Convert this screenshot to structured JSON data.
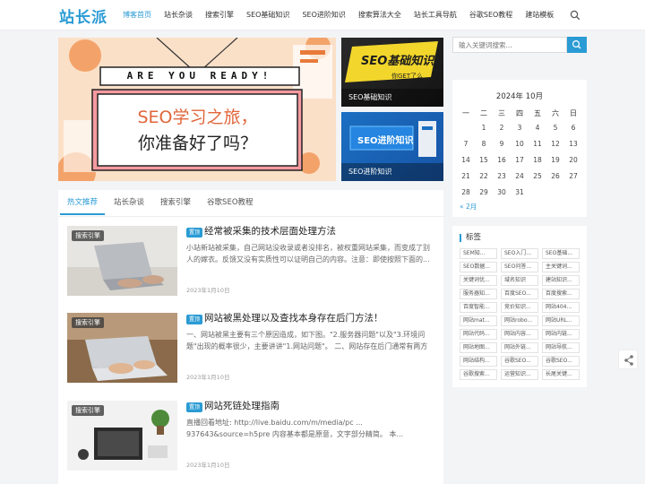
{
  "header": {
    "logo": "站长派",
    "nav": [
      "博客首页",
      "站长杂谈",
      "搜索引擎",
      "SEO基础知识",
      "SEO进阶知识",
      "搜索算法大全",
      "站长工具导航",
      "谷歌SEO教程",
      "建站模板"
    ],
    "active_index": 0
  },
  "slider": {
    "banner_top": "ARE YOU READY!",
    "banner_line1": "SEO学习之旅，",
    "banner_line2": "你准备好了吗？"
  },
  "thumbs": [
    {
      "art_title": "SEO基础知识",
      "art_sub": "你GET了么",
      "caption": "SEO基础知识"
    },
    {
      "art_title": "SEO进阶知识",
      "caption": "SEO进阶知识"
    }
  ],
  "tabs": [
    "热文推荐",
    "站长杂谈",
    "搜索引擎",
    "谷歌SEO教程"
  ],
  "posts": [
    {
      "tag": "搜索引擎",
      "badge": "置顶",
      "title": "经常被采集的技术层面处理方法",
      "summary": "小站新站被采集，自己网站没收录或者没排名，被权重网站采集，而变成了别人的嫁衣。反馈又没有实质性可以证明自己的内容。注意：即使按照下面的...",
      "date": "2023年1月10日"
    },
    {
      "tag": "搜索引擎",
      "badge": "置顶",
      "title": "网站被黑处理以及查找本身存在后门方法！",
      "summary": "一、网站被黑主要有三个原因造成，如下图。\"2.服务器问题\"以及\"3.环境问题\"出现的概率很少，主要讲讲\"1.网站问题\"。 二、网站存在后门通常有两方面...",
      "date": "2023年1月10日"
    },
    {
      "tag": "搜索引擎",
      "badge": "置顶",
      "title": "网站死链处理指南",
      "summary": "直播回看地址: http://live.baidu.com/m/media/pc ... 937643&source=h5pre 内容基本都是原意，文字部分精简。 本...",
      "date": "2023年1月10日"
    }
  ],
  "sidebar": {
    "search_placeholder": "输入关键词搜索...",
    "calendar": {
      "title": "2024年 10月",
      "weekdays": [
        "一",
        "二",
        "三",
        "四",
        "五",
        "六",
        "日"
      ],
      "days": [
        "",
        "1",
        "2",
        "3",
        "4",
        "5",
        "6",
        "7",
        "8",
        "9",
        "10",
        "11",
        "12",
        "13",
        "14",
        "15",
        "16",
        "17",
        "18",
        "19",
        "20",
        "21",
        "22",
        "23",
        "24",
        "25",
        "26",
        "27",
        "28",
        "29",
        "30",
        "31"
      ],
      "prev": "« 2月"
    },
    "tags_title": "标签",
    "tags": [
      "SEM知...",
      "SEO入门...",
      "SEO基础...",
      "SEO数据...",
      "SEO问答...",
      "主关键词...",
      "关键词优...",
      "域名知识",
      "建站知识...",
      "服务器知...",
      "百度SEO...",
      "百度搜索...",
      "百度智能...",
      "竞价知识...",
      "网站404...",
      "网站mat...",
      "网站robo...",
      "网站URL...",
      "网站代码...",
      "网站内容...",
      "网站内链...",
      "网站地图...",
      "网站外链...",
      "网站导航...",
      "网站结构...",
      "谷歌SEO...",
      "谷歌SEO...",
      "谷歌搜索...",
      "运营知识...",
      "长尾关键..."
    ]
  }
}
